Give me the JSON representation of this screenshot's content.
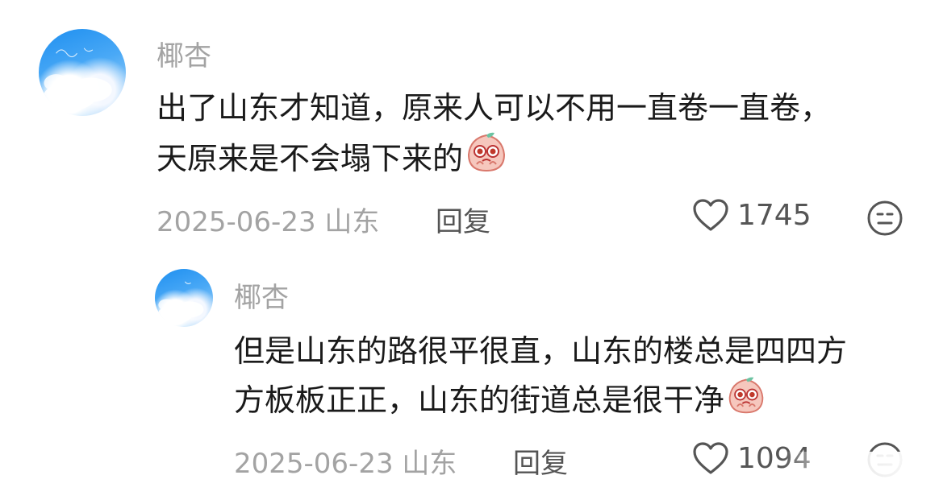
{
  "comments": [
    {
      "username": "椰杏",
      "text_lines": [
        "出了山东才知道，原来人可以不用一直卷一直卷，",
        "天原来是不会塌下来的"
      ],
      "date_location": "2025-06-23 山东",
      "reply_label": "回复",
      "likes": "1745",
      "emoji_icon": "pleading-peach-emoji",
      "react_icon": "neutral-face-icon"
    },
    {
      "username": "椰杏",
      "text_lines": [
        "但是山东的路很平很直，山东的楼总是四四方",
        "方板板正正，山东的街道总是很干净"
      ],
      "date_location": "2025-06-23 山东",
      "reply_label": "回复",
      "likes": "1094",
      "emoji_icon": "pleading-peach-emoji",
      "react_icon": "neutral-face-icon"
    }
  ],
  "colors": {
    "username": "#a3a3a3",
    "text": "#1a1a1a",
    "meta": "#a3a3a3",
    "reply": "#545454"
  }
}
